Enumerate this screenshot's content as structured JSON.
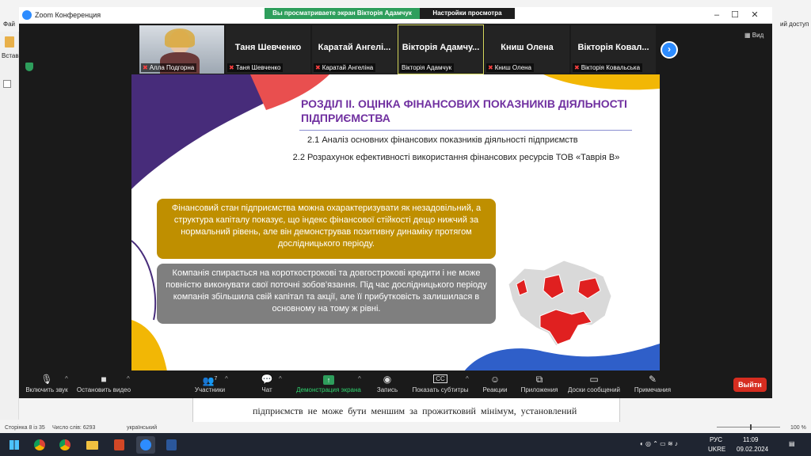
{
  "word": {
    "tab_fragment": "Фай",
    "right_fragment": "ий доступ",
    "left_fragment": "Встав",
    "doc_line": "підприємств не може бути меншим за прожитковий мінімум, установлений",
    "status": {
      "page": "Сторінка 8 із 35",
      "words": "Число слів: 6293",
      "lang": "український",
      "zoom": "100 %"
    }
  },
  "zoom": {
    "window_title": "Zoom Конференция",
    "viewing_banner": "Вы просматриваете экран Вікторія Адамчук",
    "view_settings": "Настройки просмотра",
    "view_button": "Вид",
    "participants_strip": [
      {
        "big": "",
        "name": "Алла Подгорна",
        "video": true
      },
      {
        "big": "Таня Шевченко",
        "name": "Таня Шевченко",
        "video": false
      },
      {
        "big": "Каратай Ангелі...",
        "name": "Каратай Ангеліна",
        "video": false
      },
      {
        "big": "Вікторія Адамчу...",
        "name": "Вікторія Адамчук",
        "video": false,
        "active": true
      },
      {
        "big": "Книш Олена",
        "name": "Книш Олена",
        "video": false
      },
      {
        "big": "Вікторія Ковал...",
        "name": "Вікторія Ковальська",
        "video": false
      }
    ],
    "toolbar": {
      "audio": "Включить звук",
      "video": "Остановить видео",
      "participants": "Участники",
      "participants_count": "7",
      "chat": "Чат",
      "share": "Демонстрация экрана",
      "record": "Запись",
      "captions": "Показать субтитры",
      "captions_icon": "CC",
      "reactions": "Реакции",
      "apps": "Приложения",
      "whiteboards": "Доски сообщений",
      "notes": "Примечания",
      "leave": "Выйти"
    }
  },
  "slide": {
    "title": "РОЗДІЛ ІІ. ОЦІНКА ФІНАНСОВИХ ПОКАЗНИКІВ ДІЯЛЬНОСТІ ПІДПРИЄМСТВА",
    "sub1": "2.1 Аналіз основних фінансових показників діяльності підприємств",
    "sub2": "2.2 Розрахунок ефективності використання фінансових ресурсів ТОВ «Таврія В»",
    "box1": "Фінансовий стан підприємства можна охарактеризувати як незадовільний, а структура капіталу показує, що індекс фінансової стійкості дещо нижчий за нормальний рівень, але він демонстрував позитивну динаміку протягом дослідницького періоду.",
    "box2": "Компанія спирається на короткострокові та довгострокові кредити і не може повністю виконувати свої поточні зобов’язання. Під час дослідницького періоду компанія збільшила свій капітал та акції, але її прибутковість залишилася в основному на тому ж рівні.",
    "colors": {
      "title": "#7030a0",
      "box1": "#bf8f00",
      "box2": "#7f7f7f",
      "map_highlight": "#e02020",
      "map_base": "#d9d9d9"
    }
  },
  "taskbar": {
    "lang": "РУС",
    "layout": "UKRE",
    "time": "11:09",
    "date": "09.02.2024"
  }
}
